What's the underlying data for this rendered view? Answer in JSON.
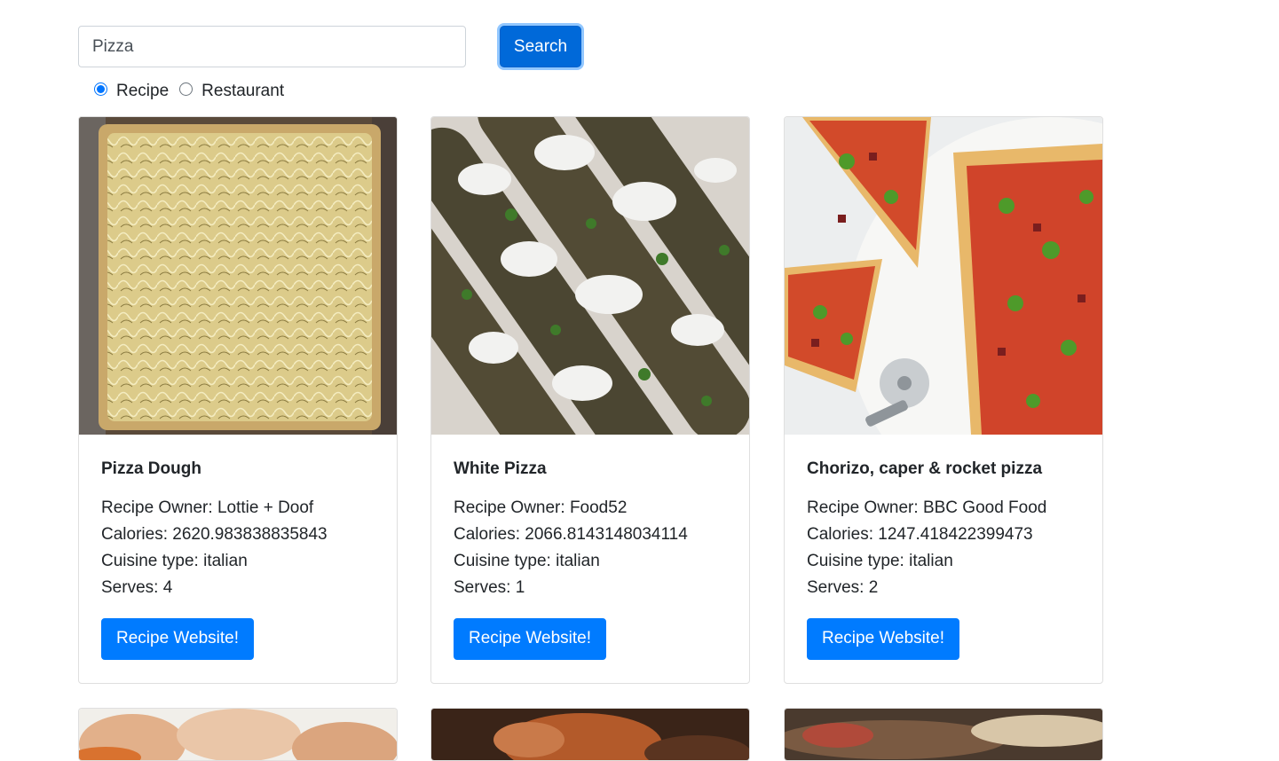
{
  "search": {
    "value": "Pizza",
    "button_label": "Search"
  },
  "search_type": {
    "options": [
      {
        "label": "Recipe",
        "checked": true
      },
      {
        "label": "Restaurant",
        "checked": false
      }
    ]
  },
  "labels": {
    "owner_prefix": "Recipe Owner: ",
    "calories_prefix": "Calories: ",
    "cuisine_prefix": "Cuisine type: ",
    "serves_prefix": "Serves: "
  },
  "cards": [
    {
      "title": "Pizza Dough",
      "owner": "Recipe Owner: Lottie + Doof",
      "calories": "Calories: 2620.983838835843",
      "cuisine": "Cuisine type: italian",
      "serves": "Serves: 4",
      "button_label": "Recipe Website!"
    },
    {
      "title": "White Pizza",
      "owner": "Recipe Owner: Food52",
      "calories": "Calories: 2066.8143148034114",
      "cuisine": "Cuisine type: italian",
      "serves": "Serves: 1",
      "button_label": "Recipe Website!"
    },
    {
      "title": "Chorizo, caper & rocket pizza",
      "owner": "Recipe Owner: BBC Good Food",
      "calories": "Calories: 1247.418422399473",
      "cuisine": "Cuisine type: italian",
      "serves": "Serves: 2",
      "button_label": "Recipe Website!"
    }
  ],
  "colors": {
    "primary": "#007bff",
    "primary_active": "#0069d9",
    "border": "#ced4da"
  }
}
